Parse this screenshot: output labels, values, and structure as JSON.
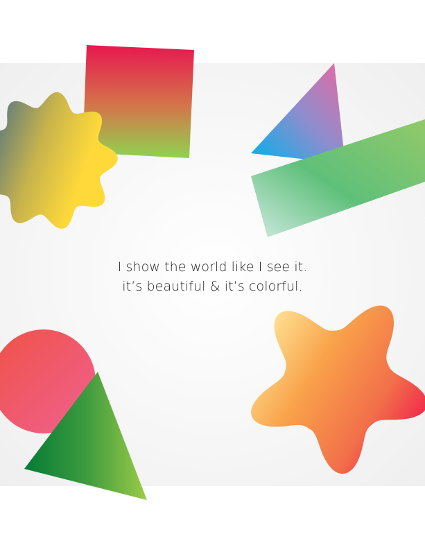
{
  "caption": {
    "line1": "I show the world like I see it.",
    "line2": "it’s beautiful & it’s colorful."
  },
  "shapes": [
    {
      "name": "gradient-square",
      "colors": [
        "#e8174f",
        "#8fd350"
      ]
    },
    {
      "name": "gradient-flower-blob",
      "colors": [
        "#33638f",
        "#ffd93a"
      ]
    },
    {
      "name": "gradient-triangle-top-right",
      "colors": [
        "#00b1eb",
        "#e769a2"
      ]
    },
    {
      "name": "gradient-bar",
      "colors": [
        "#cfe9e2",
        "#5fc07a",
        "#92c96a"
      ]
    },
    {
      "name": "gradient-circle",
      "colors": [
        "#f05145",
        "#f06292"
      ]
    },
    {
      "name": "gradient-triangle-bottom-left",
      "colors": [
        "#047c36",
        "#9bcb48"
      ]
    },
    {
      "name": "gradient-star",
      "colors": [
        "#ffe79a",
        "#f9a24a",
        "#f0144c"
      ]
    }
  ]
}
